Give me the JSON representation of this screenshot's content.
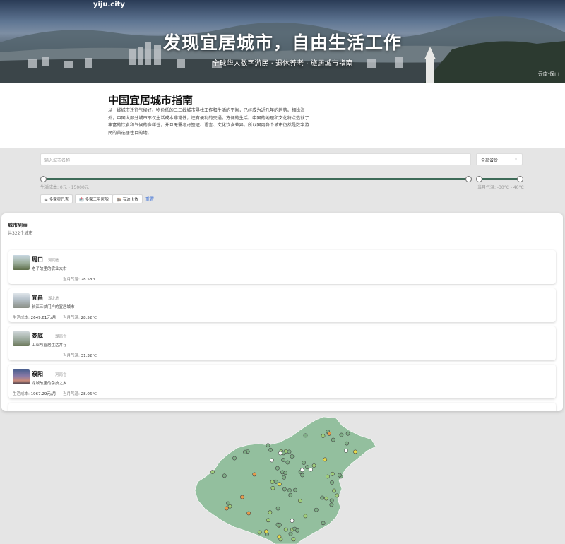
{
  "site": {
    "brand": "yiju.city"
  },
  "hero": {
    "title": "发现宜居城市，自由生活工作",
    "subtitle": "全球华人数字游民 · 退休养老 · 旅居城市指南",
    "photo_credit": "云南·保山"
  },
  "intro": {
    "heading": "中国宜居城市指南",
    "body": "从一线城市迁往气候好、物价低的二三线城市寻找工作和生活的平衡，已经成为近几年的趋势。相比海外，中国大部分城市不仅生活成本非常低，还有便利的交通，方便的生活。中国的地理和文化特点造就了丰富的饮食和气候的多样性，并且无需考虑签证、语言、文化饮食差异。所以国内各个城市仍然是数字游民的首选居住目的地。"
  },
  "filters": {
    "search_placeholder": "输入城市名称",
    "province_select": "全部省份",
    "cost_label": "生活成本: 0元 - 15000元",
    "temp_label": "当月气温: -30°C - 40°C",
    "chips": [
      "多家星巴克",
      "多家三甲医院",
      "有迪卡侬"
    ],
    "reset_label": "重置"
  },
  "list": {
    "title": "城市列表",
    "count": "共322个城市",
    "cost_prefix": "生活成本:",
    "temp_prefix": "当月气温:",
    "cities": [
      {
        "name": "周口",
        "province": "河南省",
        "desc": "老子故里的农业大市",
        "cost": "",
        "temp": "28.58°C"
      },
      {
        "name": "宜昌",
        "province": "湖北省",
        "desc": "长江三峡门户的宜居城市",
        "cost": "2649.61元/月",
        "temp": "28.52°C"
      },
      {
        "name": "娄底",
        "province": "湖南省",
        "desc": "工业与宜居生活并存",
        "cost": "",
        "temp": "31.32°C"
      },
      {
        "name": "濮阳",
        "province": "河南省",
        "desc": "龙城故里的杂技之乡",
        "cost": "1967.29元/月",
        "temp": "28.06°C"
      }
    ]
  },
  "map": {
    "land_color": "#93bf9e",
    "border_color": "#ffffff",
    "marker_colors": [
      "#7fae86",
      "#9fcd7a",
      "#e7d84a",
      "#e89a4a",
      "#d95a4a",
      "#ffffff"
    ]
  }
}
